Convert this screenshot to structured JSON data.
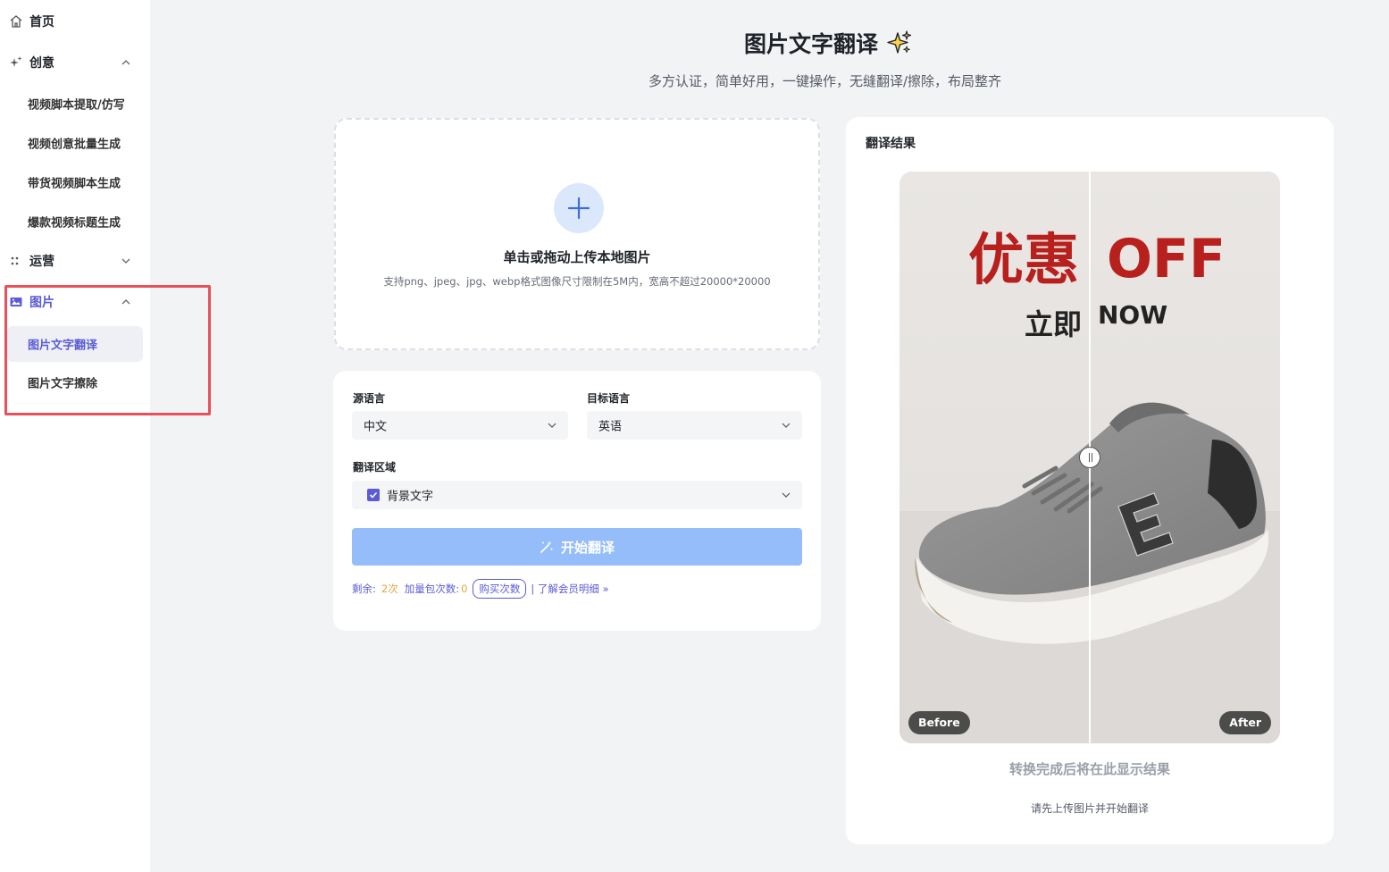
{
  "sidebar": {
    "items": [
      {
        "label": "首页",
        "icon": "home-icon"
      },
      {
        "label": "创意",
        "icon": "sparkle-icon",
        "expanded": true,
        "children": [
          "视频脚本提取/仿写",
          "视频创意批量生成",
          "带货视频脚本生成",
          "爆款视频标题生成"
        ]
      },
      {
        "label": "运营",
        "icon": "grid-icon",
        "expanded": false
      },
      {
        "label": "图片",
        "icon": "image-icon",
        "expanded": true,
        "active": true,
        "children": [
          "图片文字翻译",
          "图片文字擦除"
        ],
        "active_child": "图片文字翻译"
      }
    ]
  },
  "header": {
    "title": "图片文字翻译",
    "subtitle": "多方认证，简单好用，一键操作，无缝翻译/擦除，布局整齐"
  },
  "upload": {
    "title": "单击或拖动上传本地图片",
    "hint": "支持png、jpeg、jpg、webp格式图像尺寸限制在5M内，宽高不超过20000*20000"
  },
  "settings": {
    "source_label": "源语言",
    "source_value": "中文",
    "target_label": "目标语言",
    "target_value": "英语",
    "region_label": "翻译区域",
    "region_value": "背景文字",
    "region_checked": true,
    "start_button": "开始翻译",
    "remaining_label": "剩余:",
    "remaining_value": "2次",
    "bonus_label": "加量包次数:",
    "bonus_value": "0",
    "buy_button": "购买次数",
    "member_link": "| 了解会员明细 »"
  },
  "result": {
    "title": "翻译结果",
    "before_label": "Before",
    "after_label": "After",
    "image_text": {
      "before_main": "优惠",
      "after_main": "OFF",
      "before_sub": "立即",
      "after_sub": "NOW"
    },
    "message": "转换完成后将在此显示结果",
    "sub_message": "请先上传图片并开始翻译"
  },
  "colors": {
    "accent": "#5b5bd6",
    "button_disabled": "#94bdf9",
    "highlight": "#e8505b",
    "warning": "#e8a33c",
    "promo_red": "#b8201e"
  }
}
